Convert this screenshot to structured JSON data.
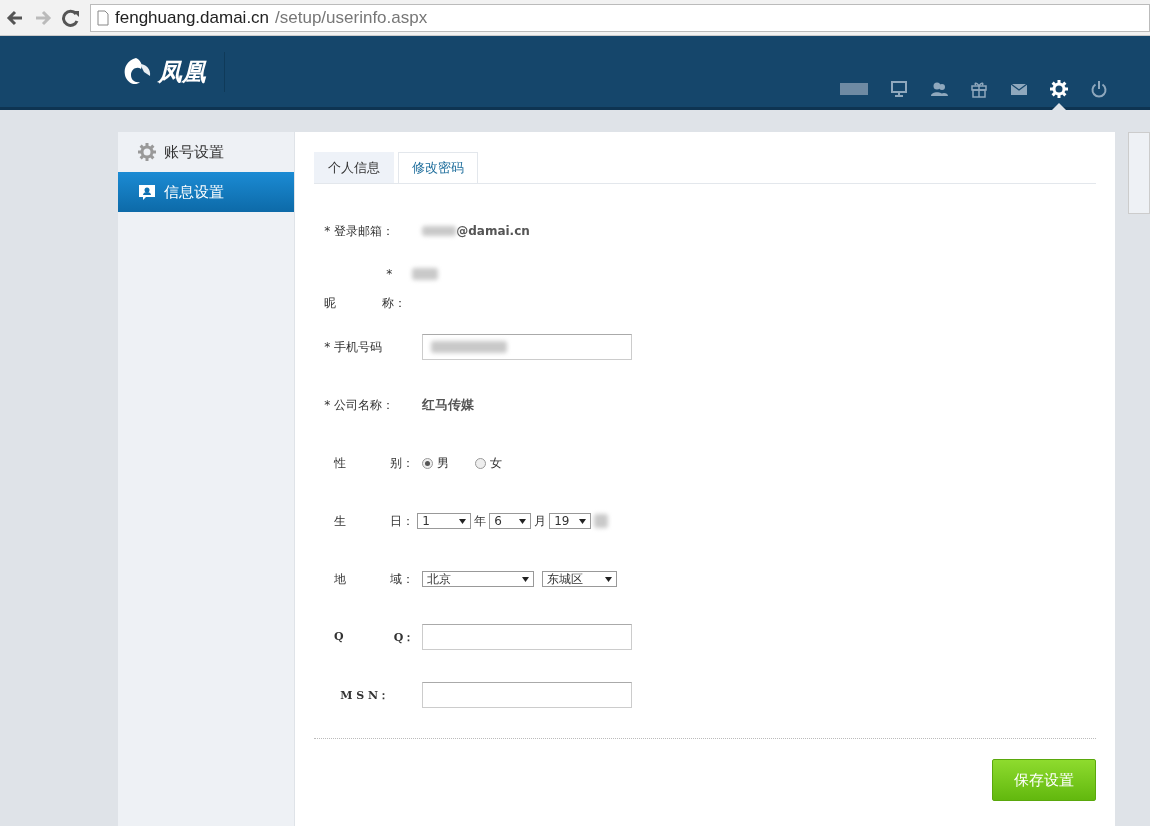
{
  "browser": {
    "url_host": "fenghuang.damai.cn",
    "url_path": "/setup/userinfo.aspx"
  },
  "header": {
    "logo_text": "凤凰",
    "nav_icons": [
      {
        "kind": "monitor",
        "selected": false
      },
      {
        "kind": "people",
        "selected": false
      },
      {
        "kind": "gift",
        "selected": false
      },
      {
        "kind": "mail",
        "selected": false
      },
      {
        "kind": "gear",
        "selected": true
      },
      {
        "kind": "power",
        "selected": false
      }
    ]
  },
  "sidebar": {
    "items": [
      {
        "label": "账号设置",
        "kind": "gear",
        "selected": false
      },
      {
        "label": "信息设置",
        "kind": "card",
        "selected": true
      }
    ]
  },
  "tabs": [
    {
      "label": "个人信息",
      "selected": true
    },
    {
      "label": "修改密码",
      "selected": false
    }
  ],
  "form": {
    "rows": [
      {
        "kind": "text",
        "required_mark": "*",
        "label": "登录邮箱：",
        "value": "@damai.cn"
      },
      {
        "kind": "nickname",
        "required_mark": "*",
        "label_start": "昵",
        "label_end": "称："
      },
      {
        "kind": "input",
        "required_mark": "*",
        "label": "手机号码"
      },
      {
        "kind": "bold",
        "required_mark": "*",
        "label": "公司名称：",
        "value": "红马传媒"
      },
      {
        "kind": "radio",
        "label_start": "性",
        "label_end": "别：",
        "options": [
          {
            "label": "男",
            "selected": true
          },
          {
            "label": "女",
            "selected": false
          }
        ]
      },
      {
        "kind": "date",
        "label_start": "生",
        "label_end": "日：",
        "year": "1",
        "year_unit": "年",
        "month": "6",
        "month_unit": "月",
        "day": "19"
      },
      {
        "kind": "region",
        "label_start": "地",
        "label_end": "域：",
        "city": "北京",
        "district": "东城区"
      },
      {
        "kind": "input",
        "label_start": "Q",
        "label_end": "Q："
      },
      {
        "kind": "input",
        "label": "M S N："
      }
    ]
  },
  "save_button": "保存设置"
}
